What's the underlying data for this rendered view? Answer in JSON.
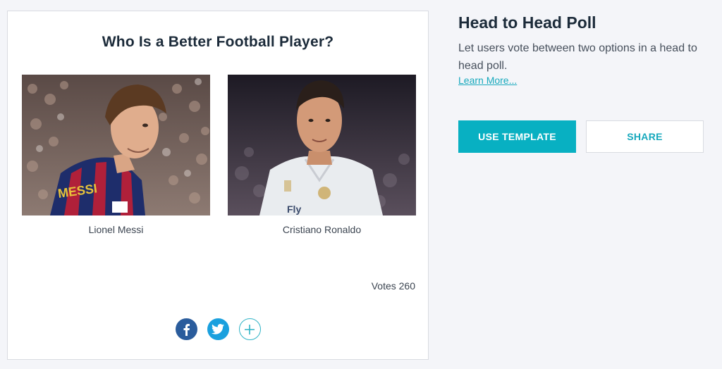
{
  "poll": {
    "title": "Who Is a Better Football Player?",
    "options": [
      {
        "name": "Lionel Messi"
      },
      {
        "name": "Cristiano Ronaldo"
      }
    ],
    "votes_text": "Votes 260",
    "share_icons": [
      "facebook-icon",
      "twitter-icon",
      "plus-icon"
    ]
  },
  "template_info": {
    "title": "Head to Head Poll",
    "description": "Let users vote between two options in a head to head poll.",
    "learn_more": "Learn More...",
    "use_template_label": "USE TEMPLATE",
    "share_label": "SHARE"
  },
  "colors": {
    "accent": "#08b0c2",
    "facebook": "#2a5c9c",
    "twitter": "#1aa0de",
    "title_text": "#1c2b3a"
  }
}
